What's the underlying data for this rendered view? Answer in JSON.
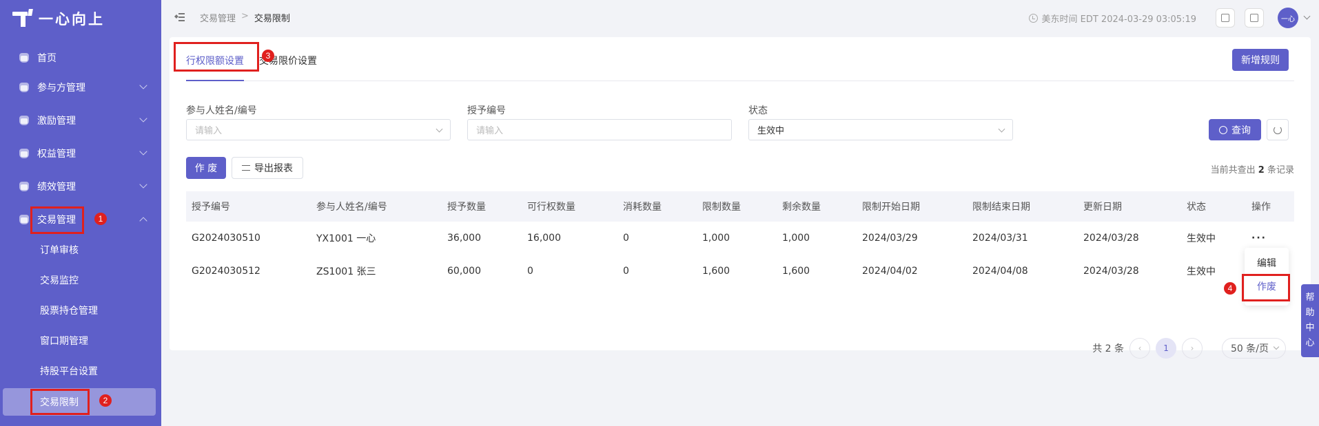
{
  "app": {
    "logo_text": "一心向上"
  },
  "sidebar": {
    "items": [
      {
        "label": "首页",
        "icon": "home-icon"
      },
      {
        "label": "参与方管理",
        "icon": "participant-icon"
      },
      {
        "label": "激励管理",
        "icon": "incentive-icon"
      },
      {
        "label": "权益管理",
        "icon": "equity-icon"
      },
      {
        "label": "绩效管理",
        "icon": "performance-icon"
      },
      {
        "label": "交易管理",
        "icon": "trade-icon",
        "expanded": true
      }
    ],
    "sub_items": [
      {
        "label": "订单审核"
      },
      {
        "label": "交易监控"
      },
      {
        "label": "股票持仓管理"
      },
      {
        "label": "窗口期管理"
      },
      {
        "label": "持股平台设置"
      },
      {
        "label": "交易限制",
        "active": true
      }
    ]
  },
  "header": {
    "breadcrumb": [
      "交易管理",
      "交易限制"
    ],
    "time": "美东时间 EDT 2024-03-29 03:05:19",
    "avatar_text": "一心"
  },
  "tabs": [
    {
      "label": "行权限额设置",
      "active": true
    },
    {
      "label": "交易限价设置",
      "active": false
    }
  ],
  "new_rule_button": "新增规则",
  "filters": {
    "participant": {
      "label": "参与人姓名/编号",
      "placeholder": "请输入"
    },
    "grant_no": {
      "label": "授予编号",
      "placeholder": "请输入"
    },
    "status": {
      "label": "状态",
      "value": "生效中"
    }
  },
  "query_button": "查询",
  "void_button": "作 废",
  "export_button": "导出报表",
  "record_count": {
    "prefix": "当前共查出",
    "count": "2",
    "suffix": "条记录"
  },
  "table": {
    "columns": [
      "授予编号",
      "参与人姓名/编号",
      "授予数量",
      "可行权数量",
      "消耗数量",
      "限制数量",
      "剩余数量",
      "限制开始日期",
      "限制结束日期",
      "更新日期",
      "状态",
      "操作"
    ],
    "rows": [
      [
        "G2024030510",
        "YX1001 一心",
        "36,000",
        "16,000",
        "0",
        "1,000",
        "1,000",
        "2024/03/29",
        "2024/03/31",
        "2024/03/28",
        "生效中",
        "···"
      ],
      [
        "G2024030512",
        "ZS1001 张三",
        "60,000",
        "0",
        "0",
        "1,600",
        "1,600",
        "2024/04/02",
        "2024/04/08",
        "2024/03/28",
        "生效中",
        ""
      ]
    ]
  },
  "action_menu": {
    "edit": "编辑",
    "void": "作废"
  },
  "pagination": {
    "total": "共 2 条",
    "current": "1",
    "page_size": "50 条/页"
  },
  "help_center": [
    "帮",
    "助",
    "中",
    "心"
  ],
  "annotations": [
    "1",
    "2",
    "3",
    "4"
  ],
  "colors": {
    "accent": "#5e5fc9",
    "annotation": "#e0201e"
  }
}
